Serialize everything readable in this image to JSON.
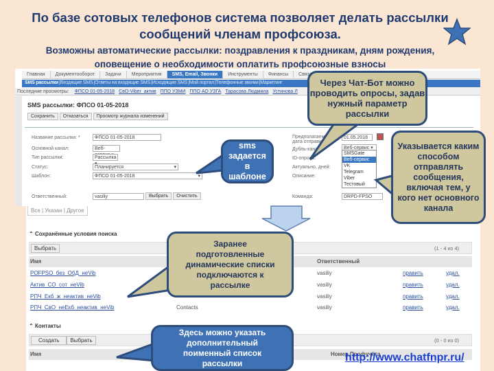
{
  "slide": {
    "title": "По базе сотовых телефонов система позволяет делать рассылки сообщений членам профсоюза.",
    "subtitle": "Возможны автоматические рассылки: поздравления к праздникам, дням рождения, оповещение о необходимости оплатить профсоюзные взносы",
    "link": "http://www.chatfnpr.ru/",
    "accent": "#1f3a6e"
  },
  "app": {
    "nav": [
      "Главная",
      "Документооборот",
      "Задачи",
      "Мероприятия",
      "SMS, Email, Звонки",
      "Инструменты",
      "Финансы",
      "Связанные таблицы"
    ],
    "subnav": [
      "SMS рассылки",
      "Входящие SMS",
      "Ответы на входящие SMS",
      "Исходящие SMS",
      "Мой портал",
      "Телефонные звонки",
      "Маркетинг"
    ],
    "recent_label": "Последние просмотры:",
    "recent": [
      "ФПСО 01-05-2018",
      "СвО-Viber_актив",
      "ППО УЗМИ",
      "ППО АО УЗГА",
      "Тарасова Людмила",
      "Устинова Л"
    ],
    "page_title": "SMS рассылки: ФПСО 01-05-2018",
    "buttons": {
      "save": "Сохранить",
      "cancel": "Отказаться",
      "history": "Просмотр журнала изменений",
      "choose": "Выбрать",
      "clear": "Очистить",
      "create": "Создать"
    },
    "form": {
      "name_label": "Название рассылки: *",
      "name": "ФПСО 01-05-2018",
      "channel_label": "Основной канал:",
      "channel": "Веб-сервис",
      "type_label": "Тип рассылки:",
      "type": "Рассылка",
      "status_label": "Статус:",
      "status": "Планируется",
      "template_label": "Шаблон:",
      "template": "ФПСО 01-05-2018",
      "owner_label": "Ответственный:",
      "owner": "vasiliy",
      "send_label": "Предполагаемая дата отправки:",
      "send_date": "01.05.2018",
      "dup_label": "Дубль-канал:",
      "dup": "Веб-сервис",
      "poll_label": "ID-опроса:",
      "days_label": "Актуально, дней:",
      "desc_label": "Описание:",
      "team_label": "Команда:",
      "team": "DRPD-FPSO",
      "dup_options": [
        "SMSGate",
        "Веб-сервис",
        "VK",
        "Telegram",
        "Viber",
        "Тестовый"
      ],
      "dup_selected": "Веб-сервис"
    },
    "tabs": [
      "Все",
      "Указан",
      "Другое"
    ],
    "saved": {
      "title": "Сохранённые условия поиска",
      "pager": "(1 - 4 из 4)",
      "columns": [
        "Имя",
        "Ответственный"
      ],
      "rows": [
        {
          "name": "POFPSO_без_ОбД_неVib",
          "type": "",
          "owner": "vasiliy"
        },
        {
          "name": "Актив_СО_сот_неVib",
          "type": "",
          "owner": "vasiliy"
        },
        {
          "name": "РПЧ_Екб_ж_неактив_неVib",
          "type": "",
          "owner": "vasiliy"
        },
        {
          "name": "РПЧ_СвО_неЕкб_неактив_неVib",
          "type": "Contacts",
          "owner": "vasiliy"
        }
      ],
      "edit": "править",
      "del": "удал."
    },
    "contacts": {
      "title": "Контакты",
      "pager": "(0 - 0 из 0)",
      "columns": [
        "Имя",
        "Номер Профучёта"
      ]
    }
  },
  "callouts": {
    "chatbot": "Через Чат-Бот можно проводить опросы, задав нужный параметр рассылки",
    "sms": "sms задается в шаблоне",
    "channel": "Указывается каким способом отправлять сообщения, включая тем, у кого нет основного канала",
    "lists": "Заранее подготовленные динамические списки подключаются к рассылке",
    "contacts": "Здесь можно указать дополнительный поименный список рассылки"
  }
}
